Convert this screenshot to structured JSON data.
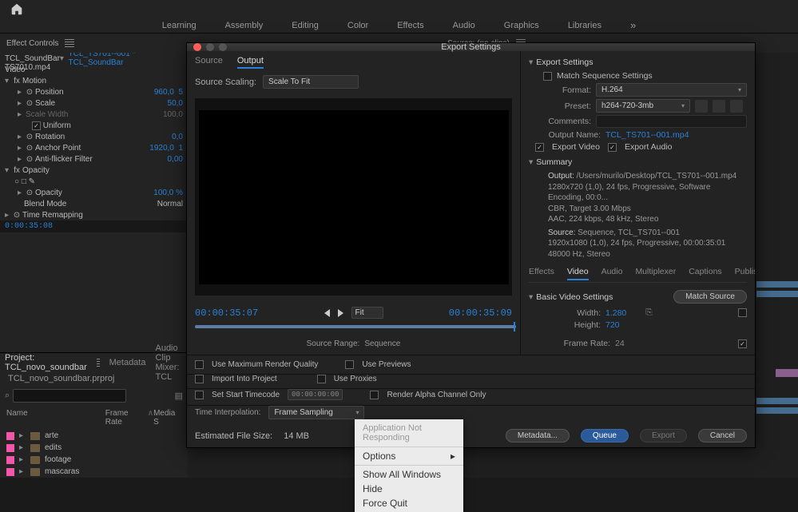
{
  "topnav": [
    "Learning",
    "Assembly",
    "Editing",
    "Color",
    "Effects",
    "Audio",
    "Graphics",
    "Libraries"
  ],
  "panel_left_title": "Effect Controls",
  "panel_right_title": "Source: (no clips)",
  "master_clip": "Master * TCL_SoundBar TS7010.mp4",
  "master_link": "TCL_TS701--001 * TCL_SoundBar",
  "fx": {
    "video": "Video",
    "motion": "Motion",
    "position": "Position",
    "position_x": "960,0",
    "position_y": "5",
    "scale": "Scale",
    "scale_v": "50,0",
    "scalew": "Scale Width",
    "scalew_v": "100,0",
    "uniform": "Uniform",
    "rotation": "Rotation",
    "rotation_v": "0,0",
    "anchor": "Anchor Point",
    "anchor_x": "1920,0",
    "anchor_y": "1",
    "flicker": "Anti-flicker Filter",
    "flicker_v": "0,00",
    "opacity": "Opacity",
    "opacity_v": "100,0 %",
    "blend": "Blend Mode",
    "blend_v": "Normal",
    "remap": "Time Remapping"
  },
  "tc_panel": "0:00:35:08",
  "project": {
    "tab": "Project: TCL_novo_soundbar",
    "metadata": "Metadata",
    "acm": "Audio Clip Mixer: TCL",
    "file": "TCL_novo_soundbar.prproj",
    "cols": {
      "name": "Name",
      "fr": "Frame Rate",
      "ms": "Media S"
    },
    "bins": [
      "arte",
      "edits",
      "footage",
      "mascaras"
    ]
  },
  "export": {
    "title": "Export Settings",
    "tabs": {
      "source": "Source",
      "output": "Output"
    },
    "scale_lbl": "Source Scaling:",
    "scale_val": "Scale To Fit",
    "tc_in": "00:00:35:07",
    "tc_out": "00:00:35:09",
    "fit": "Fit",
    "srcrange_lbl": "Source Range:",
    "srcrange_val": "Sequence",
    "settings_head": "Export Settings",
    "match_seq": "Match Sequence Settings",
    "format_lbl": "Format:",
    "format_val": "H.264",
    "preset_lbl": "Preset:",
    "preset_val": "h264-720-3mb",
    "comments_lbl": "Comments:",
    "outname_lbl": "Output Name:",
    "outname_val": "TCL_TS701--001.mp4",
    "exp_video": "Export Video",
    "exp_audio": "Export Audio",
    "summary_head": "Summary",
    "sum_out_lbl": "Output:",
    "sum_out_1": "/Users/murilo/Desktop/TCL_TS701--001.mp4",
    "sum_out_2": "1280x720 (1,0), 24 fps, Progressive, Software Encoding, 00:0...",
    "sum_out_3": "CBR, Target 3.00 Mbps",
    "sum_out_4": "AAC, 224 kbps, 48 kHz, Stereo",
    "sum_src_lbl": "Source:",
    "sum_src_1": "Sequence, TCL_TS701--001",
    "sum_src_2": "1920x1080 (1,0), 24 fps, Progressive, 00:00:35:01",
    "sum_src_3": "48000 Hz, Stereo",
    "tabs2": [
      "Effects",
      "Video",
      "Audio",
      "Multiplexer",
      "Captions",
      "Publish"
    ],
    "bvs": "Basic Video Settings",
    "match_src": "Match Source",
    "width_lbl": "Width:",
    "width_v": "1.280",
    "height_lbl": "Height:",
    "height_v": "720",
    "fr_lbl": "Frame Rate:",
    "fr_v": "24",
    "maxq": "Use Maximum Render Quality",
    "previews": "Use Previews",
    "import": "Import Into Project",
    "proxies": "Use Proxies",
    "starttc": "Set Start Timecode",
    "starttc_v": "00:00:00:00",
    "alpha": "Render Alpha Channel Only",
    "interp_lbl": "Time Interpolation:",
    "interp_v": "Frame Sampling",
    "est_lbl": "Estimated File Size:",
    "est_v": "14 MB",
    "btn_meta": "Metadata...",
    "btn_queue": "Queue",
    "btn_export": "Export",
    "btn_cancel": "Cancel"
  },
  "context_menu": {
    "head": "Application Not Responding",
    "options": "Options",
    "showall": "Show All Windows",
    "hide": "Hide",
    "force": "Force Quit"
  }
}
